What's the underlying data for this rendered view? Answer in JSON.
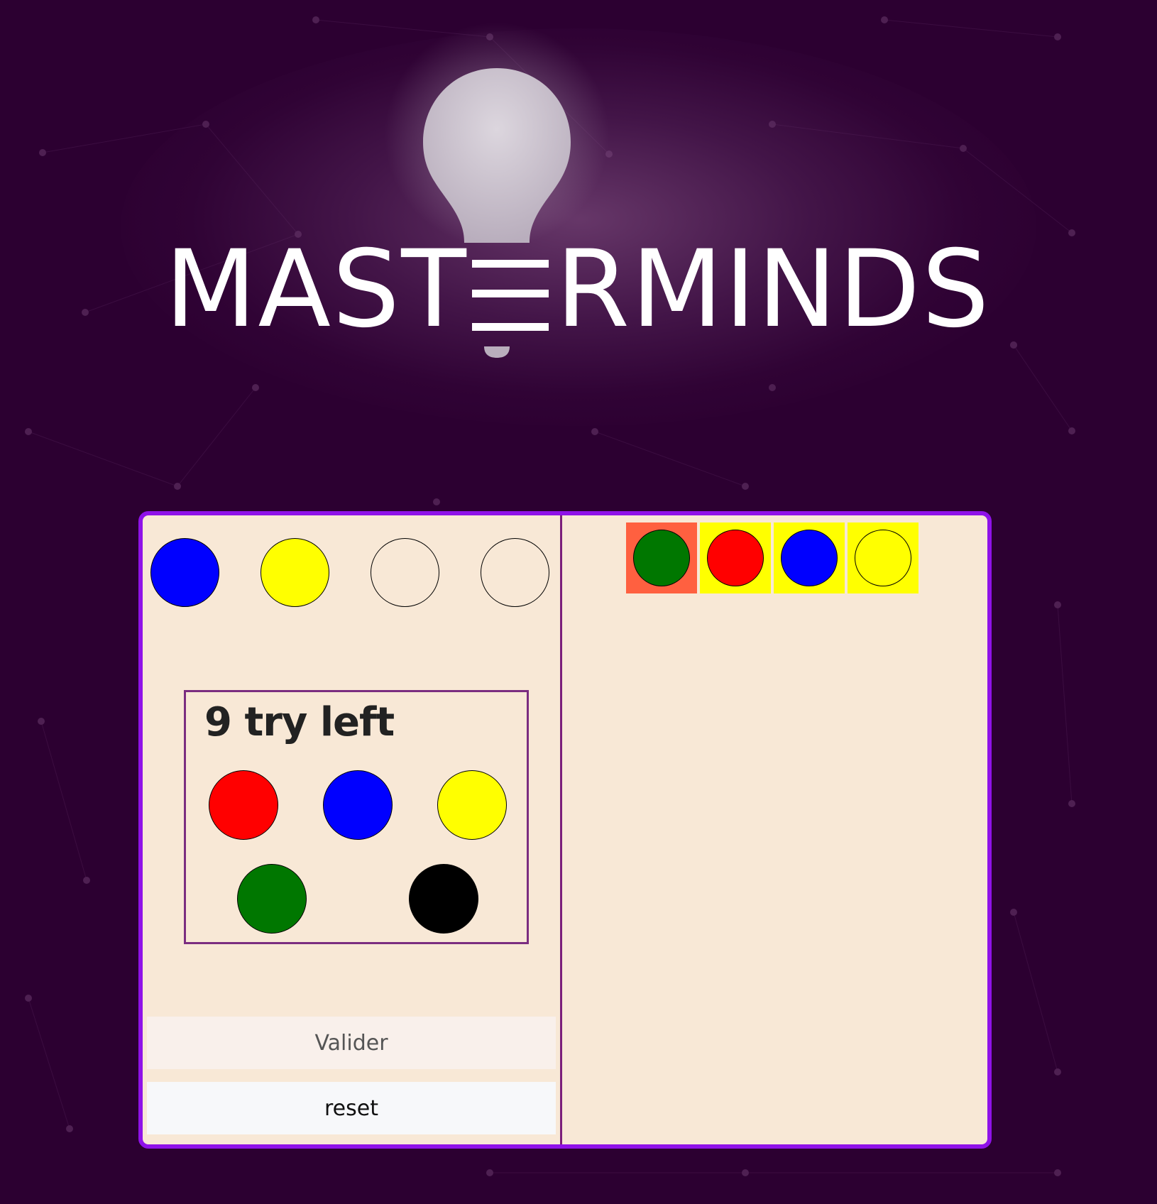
{
  "logo": {
    "text_left": "MAST",
    "text_right": "RMINDS",
    "icon": "lightbulb-icon"
  },
  "colors": {
    "background": "#2c0031",
    "board_border": "#8f12e8",
    "board_fill": "#f8e8d6",
    "blue": "#0000ff",
    "yellow": "#ffff00",
    "red": "#ff0000",
    "green": "#007700",
    "black": "#000000",
    "empty": "#f8e8d6",
    "feedback_wrong_place": "#ff6040",
    "feedback_correct": "#ffff00"
  },
  "current_guess": [
    "#0000ff",
    "#ffff00",
    "empty",
    "empty"
  ],
  "palette": {
    "tries_left": "9 try left",
    "colors": [
      "red",
      "blue",
      "yellow",
      "green",
      "black"
    ]
  },
  "buttons": {
    "validate_label": "Valider",
    "reset_label": "reset"
  },
  "history": [
    {
      "pegs": [
        {
          "color": "green",
          "feedback": "#ff6040"
        },
        {
          "color": "red",
          "feedback": "#ffff00"
        },
        {
          "color": "blue",
          "feedback": "#ffff00"
        },
        {
          "color": "yellow",
          "feedback": "#ffff00"
        }
      ]
    }
  ]
}
